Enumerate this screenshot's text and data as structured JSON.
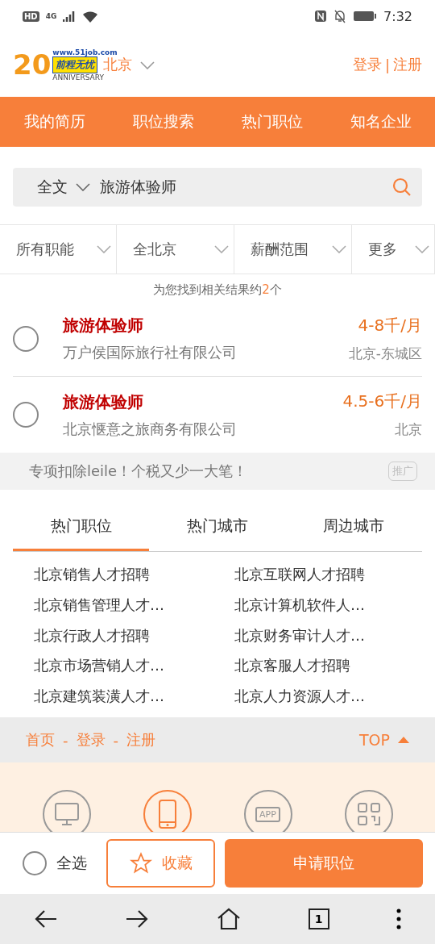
{
  "status_bar": {
    "left": [
      "HD",
      "4G"
    ],
    "time": "7:32"
  },
  "header": {
    "logo": {
      "number": "20",
      "url": "www.51job.com",
      "brand": "前程无忧",
      "tagline": "ANNIVERSARY"
    },
    "city": "北京",
    "login": "登录",
    "separator": "|",
    "register": "注册"
  },
  "nav": [
    {
      "label": "我的简历"
    },
    {
      "label": "职位搜索"
    },
    {
      "label": "热门职位"
    },
    {
      "label": "知名企业"
    }
  ],
  "search": {
    "scope": "全文",
    "value": "旅游体验师"
  },
  "filters": [
    {
      "label": "所有职能"
    },
    {
      "label": "全北京"
    },
    {
      "label": "薪酬范围"
    },
    {
      "label": "更多"
    }
  ],
  "result_count": {
    "prefix": "为您找到相关结果约",
    "count": "2",
    "suffix": "个"
  },
  "jobs": [
    {
      "title": "旅游体验师",
      "company": "万户侯国际旅行社有限公司",
      "salary": "4-8千/月",
      "location": "北京-东城区",
      "checked": false
    },
    {
      "title": "旅游体验师",
      "company": "北京惬意之旅商务有限公司",
      "salary": "4.5-6千/月",
      "location": "北京",
      "checked": false
    }
  ],
  "ad": {
    "text": "专项扣除leile！个税又少一大笔！",
    "badge": "推广"
  },
  "tabs": [
    {
      "label": "热门职位",
      "selected": true
    },
    {
      "label": "热门城市",
      "selected": false
    },
    {
      "label": "周边城市",
      "selected": false
    }
  ],
  "links": [
    "北京销售人才招聘",
    "北京互联网人才招聘",
    "北京销售管理人才…",
    "北京计算机软件人…",
    "北京行政人才招聘",
    "北京财务审计人才…",
    "北京市场营销人才…",
    "北京客服人才招聘",
    "北京建筑装潢人才…",
    "北京人力资源人才…"
  ],
  "footer": {
    "links": [
      "首页",
      "登录",
      "注册"
    ],
    "separator": "-",
    "top": "TOP"
  },
  "download": [
    {
      "kind": "desktop",
      "selected": false
    },
    {
      "kind": "tablet",
      "selected": true
    },
    {
      "kind": "app",
      "label": "APP",
      "selected": false
    },
    {
      "kind": "qr",
      "selected": false
    }
  ],
  "action_bar": {
    "select_all": {
      "label": "全选",
      "checked": false
    },
    "favorite": "收藏",
    "apply": "申请职位"
  },
  "browser_bar": {
    "tabs_count": "1"
  }
}
